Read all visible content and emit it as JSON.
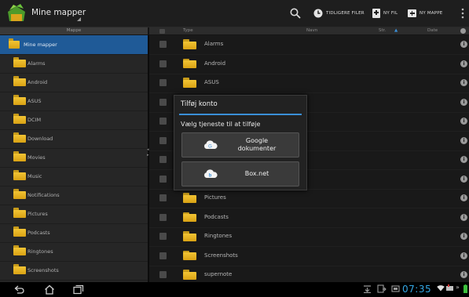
{
  "actionbar": {
    "title": "Mine mapper",
    "recent_label": "TIDLIGERE FILER",
    "new_file_label": "NY FIL",
    "new_folder_label": "NY MAPPE"
  },
  "left_header": "Mappe",
  "right_header": {
    "type": "Type",
    "name": "Navn",
    "size": "Str.",
    "sort": "▲",
    "date": "Date"
  },
  "left_items": [
    "Mine mapper",
    "Alarms",
    "Android",
    "ASUS",
    "DCIM",
    "Download",
    "Movies",
    "Music",
    "Notifications",
    "Pictures",
    "Podcasts",
    "Ringtones",
    "Screenshots"
  ],
  "right_items": [
    "Alarms",
    "Android",
    "ASUS",
    "",
    "",
    "",
    "",
    "",
    "Pictures",
    "Podcasts",
    "Ringtones",
    "Screenshots",
    "supernote"
  ],
  "dialog": {
    "title": "Tilføj konto",
    "message": "Vælg tjeneste til at tilføje",
    "option1_line1": "Google",
    "option1_line2": "dokumenter",
    "option2": "Box.net"
  },
  "status": {
    "time": "07:35"
  },
  "colors": {
    "accent": "#3a8fd8",
    "selected_row": "#1f5a97",
    "folder": "#f2c434",
    "clock": "#34a8e6"
  }
}
